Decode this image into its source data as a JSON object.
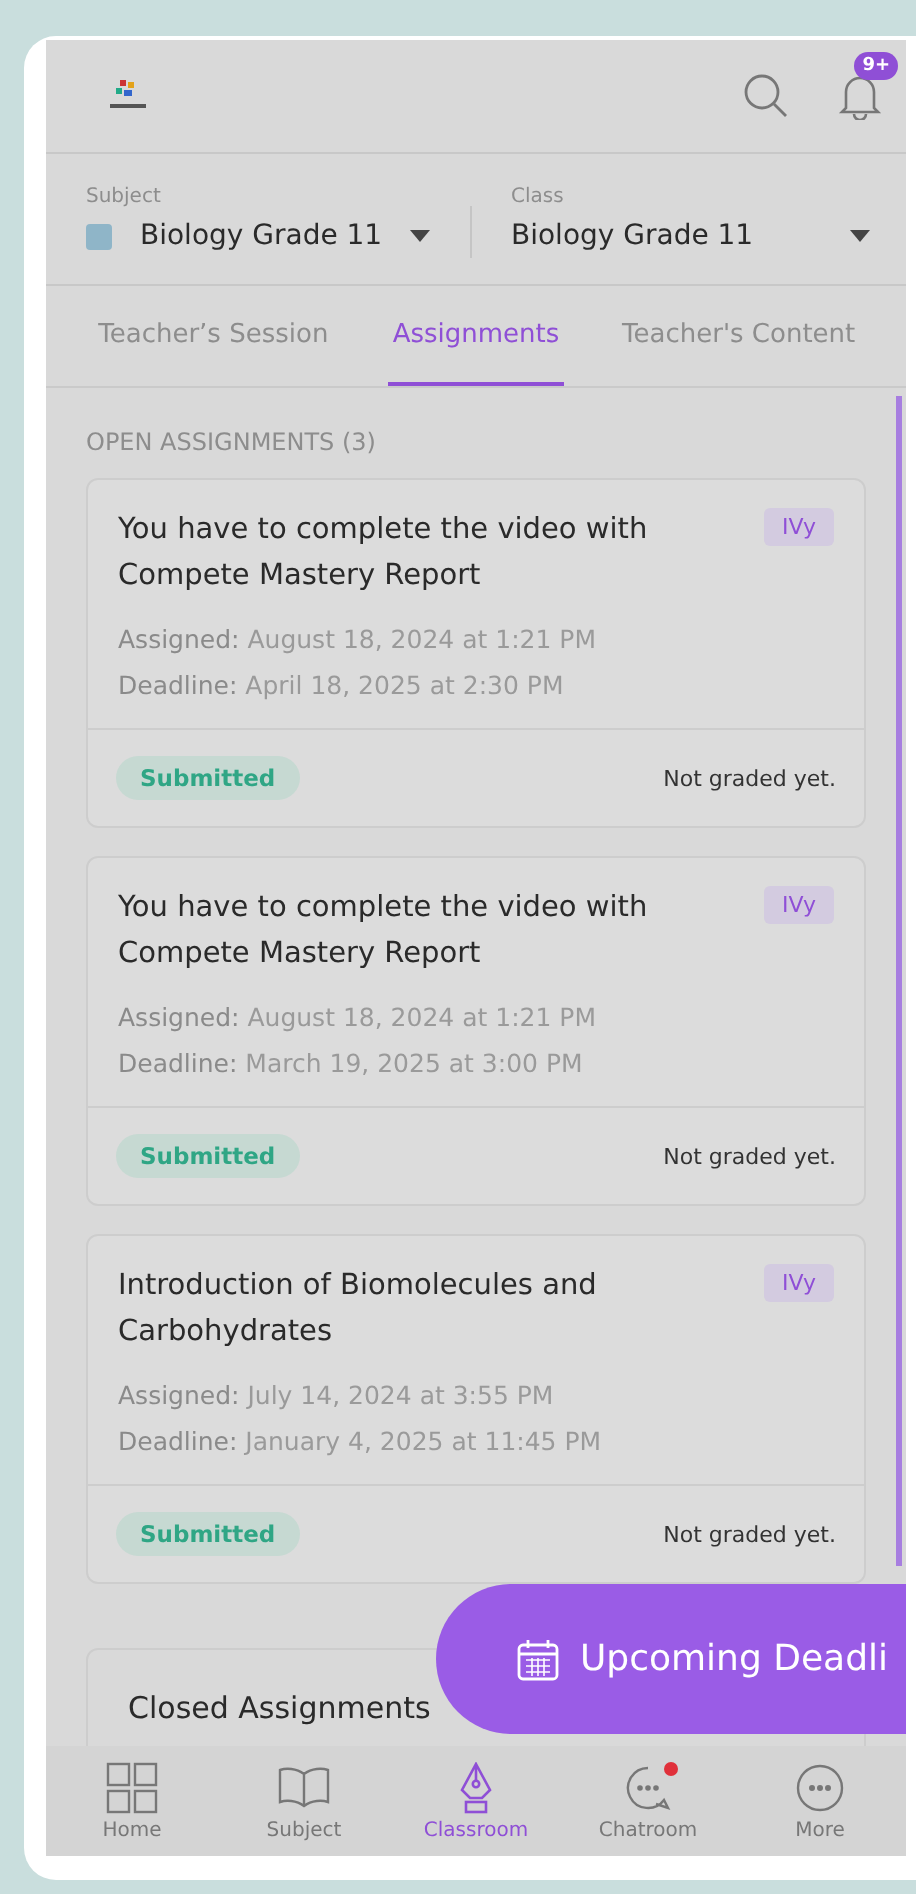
{
  "header": {
    "notification_badge": "9+"
  },
  "selectors": [
    {
      "label": "Subject",
      "value": "Biology Grade 11",
      "has_image": true
    },
    {
      "label": "Class",
      "value": "Biology Grade 11",
      "has_image": false
    }
  ],
  "tabs": [
    {
      "label": "Teacher’s Session",
      "selected": false
    },
    {
      "label": "Assignments",
      "selected": true
    },
    {
      "label": "Teacher's Content",
      "selected": false
    }
  ],
  "section_title": "OPEN ASSIGNMENTS (3)",
  "assignments": [
    {
      "title": "You have to complete the video with Compete Mastery Report",
      "tag": "IVy",
      "assigned_label": "Assigned:",
      "assigned": "August 18, 2024 at 1:21 PM",
      "deadline_label": "Deadline:",
      "deadline": "April 18, 2025 at 2:30 PM",
      "status": "Submitted",
      "grade": "Not graded yet."
    },
    {
      "title": "You have to complete the video with Compete Mastery Report",
      "tag": "IVy",
      "assigned_label": "Assigned:",
      "assigned": "August 18, 2024 at 1:21 PM",
      "deadline_label": "Deadline:",
      "deadline": "March 19, 2025 at 3:00 PM",
      "status": "Submitted",
      "grade": "Not graded yet."
    },
    {
      "title": "Introduction of Biomolecules and Carbohydrates",
      "tag": "IVy",
      "assigned_label": "Assigned:",
      "assigned": "July 14, 2024 at 3:55 PM",
      "deadline_label": "Deadline:",
      "deadline": "January 4, 2025 at 11:45 PM",
      "status": "Submitted",
      "grade": "Not graded yet."
    }
  ],
  "closed": {
    "title": "Closed Assignments"
  },
  "floating_button": {
    "label": "Upcoming Deadli"
  },
  "nav": [
    {
      "kind": "home",
      "label": "Home",
      "selected": false,
      "dot": false
    },
    {
      "kind": "subject",
      "label": "Subject",
      "selected": false,
      "dot": false
    },
    {
      "kind": "classroom",
      "label": "Classroom",
      "selected": true,
      "dot": false
    },
    {
      "kind": "chatroom",
      "label": "Chatroom",
      "selected": false,
      "dot": true
    },
    {
      "kind": "more",
      "label": "More",
      "selected": false,
      "dot": false
    }
  ]
}
